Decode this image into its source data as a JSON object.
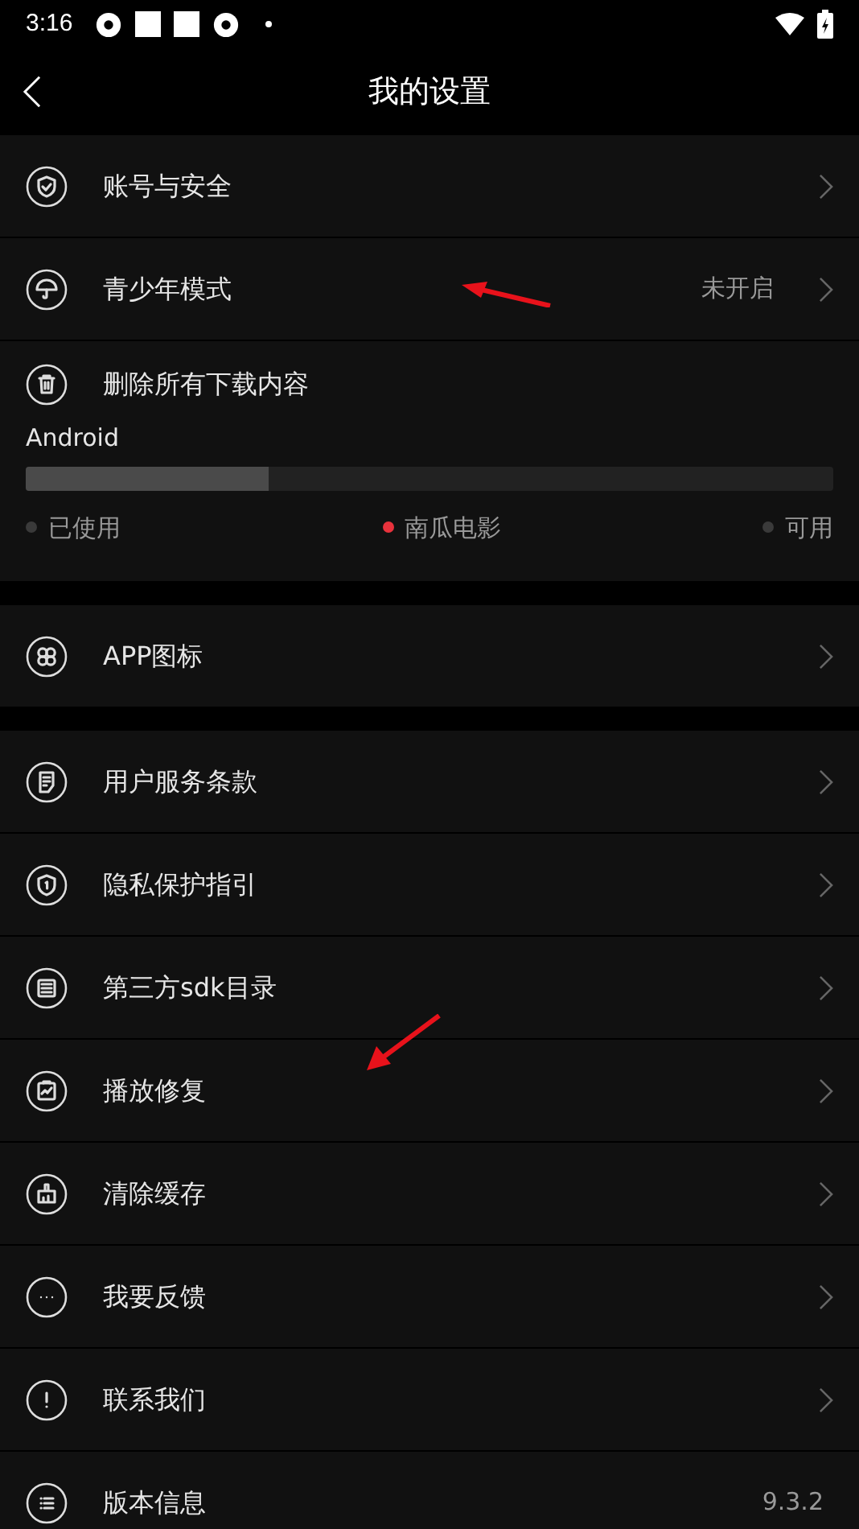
{
  "status_bar": {
    "time": "3:16"
  },
  "header": {
    "title": "我的设置"
  },
  "groups": [
    {
      "items": [
        {
          "kind": "link",
          "label": "账号与安全"
        },
        {
          "kind": "link",
          "label": "青少年模式",
          "value": "未开启"
        },
        {
          "kind": "storage",
          "label": "删除所有下载内容",
          "device": "Android",
          "level": 0.3,
          "legend": [
            {
              "label": "已使用",
              "color": "#3a3a3a"
            },
            {
              "label": "南瓜电影",
              "color": "#e8323c"
            },
            {
              "label": "可用",
              "color": "#3a3a3a"
            }
          ]
        }
      ]
    },
    {
      "items": [
        {
          "kind": "link",
          "label": "APP图标"
        }
      ]
    },
    {
      "items": [
        {
          "kind": "link",
          "label": "用户服务条款"
        },
        {
          "kind": "link",
          "label": "隐私保护指引"
        },
        {
          "kind": "link",
          "label": "第三方sdk目录"
        },
        {
          "kind": "link",
          "label": "播放修复"
        },
        {
          "kind": "link",
          "label": "清除缓存"
        },
        {
          "kind": "link",
          "label": "我要反馈"
        },
        {
          "kind": "link",
          "label": "联系我们"
        },
        {
          "kind": "version",
          "label": "版本信息",
          "value": "9.3.2"
        }
      ]
    }
  ]
}
